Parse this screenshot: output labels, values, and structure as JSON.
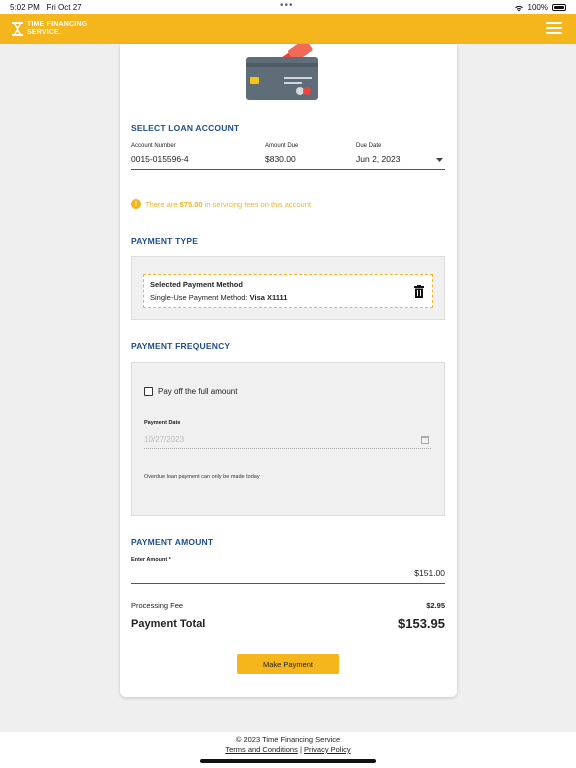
{
  "status_bar": {
    "time": "5:02 PM",
    "date": "Fri Oct 27",
    "battery": "100%"
  },
  "app": {
    "logo_line1": "TIME FINANCING",
    "logo_line2": "SERVICE."
  },
  "loan_account": {
    "section_title": "SELECT LOAN ACCOUNT",
    "account_number_label": "Account Number",
    "account_number": "0015-015596-4",
    "amount_due_label": "Amount Due",
    "amount_due": "$830.00",
    "due_date_label": "Due Date",
    "due_date": "Jun 2, 2023"
  },
  "fee_notice": {
    "prefix": "There are",
    "amount": "$75.00",
    "suffix": "in servicing fees on this account"
  },
  "payment_type": {
    "section_title": "PAYMENT TYPE",
    "selected_title": "Selected Payment Method",
    "method_prefix": "Single-Use Payment Method:",
    "method_value": "Visa X1111"
  },
  "payment_frequency": {
    "section_title": "PAYMENT FREQUENCY",
    "pay_full_label": "Pay off the full amount",
    "pay_full_checked": false,
    "payment_date_label": "Payment Date",
    "payment_date_value": "10/27/2023",
    "overdue_note": "Overdue loan payment can only be made today"
  },
  "payment_amount": {
    "section_title": "PAYMENT AMOUNT",
    "enter_amount_label": "Enter Amount *",
    "amount_value": "$151.00",
    "processing_fee_label": "Processing Fee",
    "processing_fee_value": "$2.95",
    "total_label": "Payment Total",
    "total_value": "$153.95"
  },
  "actions": {
    "make_payment_label": "Make Payment"
  },
  "footer": {
    "copyright": "© 2023 Time Financing Service",
    "terms_label": "Terms and Conditions",
    "separator": "|",
    "privacy_label": "Privacy Policy"
  },
  "colors": {
    "brand_yellow": "#f5b51c",
    "section_blue": "#1f4e8c",
    "card_gray": "#5e6d78",
    "card_red": "#e8453c"
  },
  "icons": [
    "wifi-icon",
    "battery-icon",
    "logo-icon",
    "menu-icon",
    "credit-card-illustration",
    "info-icon",
    "chevron-down-icon",
    "trash-icon",
    "calendar-icon"
  ]
}
